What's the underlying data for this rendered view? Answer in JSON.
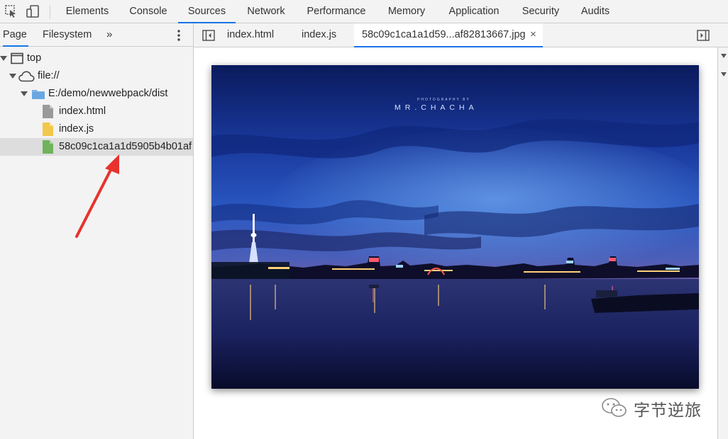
{
  "toolbar": {
    "icons": [
      "inspect-element-icon",
      "device-toolbar-icon"
    ],
    "tabs": [
      {
        "label": "Elements",
        "active": false
      },
      {
        "label": "Console",
        "active": false
      },
      {
        "label": "Sources",
        "active": true
      },
      {
        "label": "Network",
        "active": false
      },
      {
        "label": "Performance",
        "active": false
      },
      {
        "label": "Memory",
        "active": false
      },
      {
        "label": "Application",
        "active": false
      },
      {
        "label": "Security",
        "active": false
      },
      {
        "label": "Audits",
        "active": false
      }
    ]
  },
  "navigator": {
    "tabs": [
      {
        "label": "Page",
        "active": true
      },
      {
        "label": "Filesystem",
        "active": false
      }
    ],
    "more_label": "»",
    "tree": [
      {
        "label": "top",
        "depth": 0,
        "icon": "frame-icon",
        "expanded": true
      },
      {
        "label": "file://",
        "depth": 1,
        "icon": "cloud-icon",
        "expanded": true
      },
      {
        "label": "E:/demo/newwebpack/dist",
        "depth": 2,
        "icon": "folder-icon",
        "expanded": true
      },
      {
        "label": "index.html",
        "depth": 3,
        "icon": "html-file-icon"
      },
      {
        "label": "index.js",
        "depth": 3,
        "icon": "js-file-icon"
      },
      {
        "label": "58c09c1ca1a1d5905b4b01af",
        "depth": 3,
        "icon": "image-file-icon",
        "selected": true
      }
    ]
  },
  "editor": {
    "tabs": [
      {
        "label": "index.html",
        "active": false
      },
      {
        "label": "index.js",
        "active": false
      },
      {
        "label": "58c09c1ca1a1d59...af82813667.jpg",
        "active": true
      }
    ],
    "close_label": "×"
  },
  "preview": {
    "credit_small": "PHOTOGRAPHY BY",
    "credit_big": "MR.CHACHA"
  },
  "watermark": {
    "text": "字节逆旅"
  },
  "colors": {
    "accent": "#1a73e8",
    "annotation_arrow": "#e8322d",
    "panel_bg": "#f3f3f3",
    "selected_row": "#dddddd"
  }
}
